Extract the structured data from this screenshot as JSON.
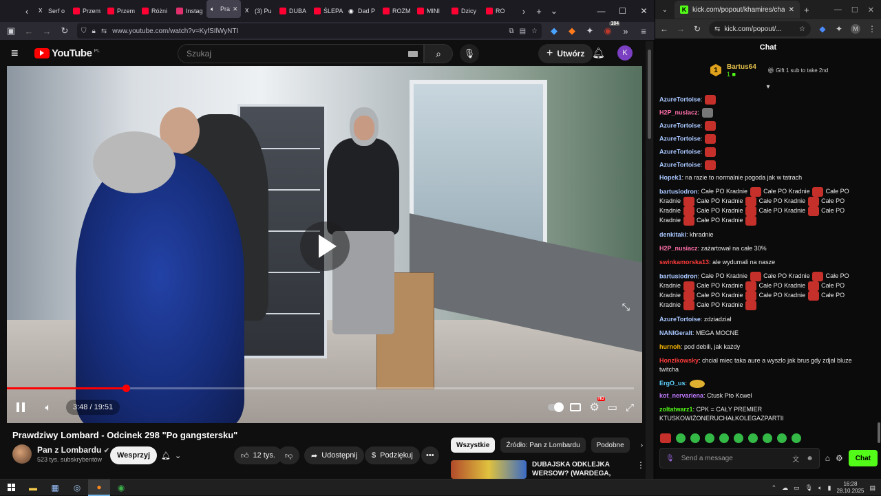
{
  "left_browser": {
    "tabs": [
      {
        "label": "Serf o",
        "color": "#ffffff",
        "icon": "x-icon"
      },
      {
        "label": "Przem",
        "color": "#ff0033",
        "icon": "youtube-icon"
      },
      {
        "label": "Przem",
        "color": "#ff0033",
        "icon": "youtube-icon"
      },
      {
        "label": "Różni",
        "color": "#ff0033",
        "icon": "youtube-icon"
      },
      {
        "label": "Instag",
        "color": "#e1306c",
        "icon": "instagram-icon"
      },
      {
        "label": "Pra",
        "color": "#ff0033",
        "icon": "speaker-icon",
        "active": true
      },
      {
        "label": "(3) Pu",
        "color": "#ffffff",
        "icon": "x-icon"
      },
      {
        "label": "DUBA",
        "color": "#ff0033",
        "icon": "youtube-icon"
      },
      {
        "label": "ŚLEPA",
        "color": "#ff0033",
        "icon": "youtube-icon"
      },
      {
        "label": "Dad P",
        "color": "#ffffff",
        "icon": "record-icon"
      },
      {
        "label": "ROZM",
        "color": "#ff0033",
        "icon": "youtube-icon"
      },
      {
        "label": "MINI",
        "color": "#ff0033",
        "icon": "youtube-icon"
      },
      {
        "label": "Dzicy",
        "color": "#ff0033",
        "icon": "youtube-icon"
      },
      {
        "label": "RO",
        "color": "#ff0033",
        "icon": "youtube-icon"
      }
    ],
    "url": "www.youtube.com/watch?v=KyfSIlWyNTI",
    "extension_badge": "184"
  },
  "youtube": {
    "logo_text": "YouTube",
    "region": "PL",
    "search_placeholder": "Szukaj",
    "create_label": "Utwórz",
    "avatar_letter": "K",
    "player": {
      "current_time": "3:48",
      "duration": "19:51",
      "time_display": "3:48 / 19:51",
      "progress_fraction": 0.19
    },
    "video_title": "Prawdziwy Lombard - Odcinek 298 \"Po gangstersku\"",
    "channel_name": "Pan z Lombardu",
    "subscribers": "523 tys. subskrybentów",
    "support_label": "Wesprzyj",
    "likes": "12 tys.",
    "share_label": "Udostępnij",
    "thanks_label": "Podziękuj",
    "filters": [
      "Wszystkie",
      "Źródło: Pan z Lombardu",
      "Podobne"
    ],
    "recommended_title": "DUBAJSKA ODKLEJKA WERSOW? (WARDEGA, NITRO"
  },
  "right_browser": {
    "tab_label": "kick.com/popout/khamires/cha",
    "url": "kick.com/popout/...",
    "profile_letter": "M"
  },
  "chat": {
    "header": "Chat",
    "pinned": {
      "rank": "1",
      "user": "Bartus64",
      "count": "1",
      "gift_text": "Gift 1 sub to take 2nd"
    },
    "messages": [
      {
        "user": "AzureTortoise",
        "color": "#a9c7ff",
        "text": "",
        "emotes": 1,
        "emote_type": "red"
      },
      {
        "user": "H2P_nusiacz",
        "color": "#ff6fa8",
        "text": "",
        "emotes": 1,
        "emote_type": "gray"
      },
      {
        "user": "AzureTortoise",
        "color": "#a9c7ff",
        "text": "",
        "emotes": 1,
        "emote_type": "red"
      },
      {
        "user": "AzureTortoise",
        "color": "#a9c7ff",
        "text": "",
        "emotes": 1,
        "emote_type": "red"
      },
      {
        "user": "AzureTortoise",
        "color": "#a9c7ff",
        "text": "",
        "emotes": 1,
        "emote_type": "red"
      },
      {
        "user": "AzureTortoise",
        "color": "#a9c7ff",
        "text": "",
        "emotes": 1,
        "emote_type": "red"
      },
      {
        "user": "Hopek1",
        "color": "#a9c7ff",
        "text": "na razie to normalnie pogoda jak w tatrach",
        "emotes": 0
      },
      {
        "user": "bartusiodron",
        "color": "#a9c7ff",
        "text": "Całe PO Kradnie [e] Całe PO Kradnie [e] Całe PO Kradnie [e] Całe PO Kradnie [e] Całe PO Kradnie [e] Całe PO Kradnie [e] Całe PO Kradnie [e] Całe PO Kradnie [e] Całe PO Kradnie [e] Całe PO Kradnie [e]",
        "emotes": 0
      },
      {
        "user": "denkitaki",
        "color": "#a9c7ff",
        "text": "khradnie",
        "emotes": 0
      },
      {
        "user": "H2P_nusiacz",
        "color": "#ff6fa8",
        "text": "zażartował na całe 30%",
        "emotes": 0
      },
      {
        "user": "swinkamorska13",
        "color": "#ff3b3b",
        "text": "ale wydumali na nasze",
        "emotes": 0
      },
      {
        "user": "bartusiodron",
        "color": "#a9c7ff",
        "text": "Całe PO Kradnie [e] Całe PO Kradnie [e] Całe PO Kradnie [e] Całe PO Kradnie [e] Całe PO Kradnie [e] Całe PO Kradnie [e] Całe PO Kradnie [e] Całe PO Kradnie [e] Całe PO Kradnie [e] Całe PO Kradnie [e]",
        "emotes": 0
      },
      {
        "user": "AzureTortoise",
        "color": "#a9c7ff",
        "text": "zdziadział",
        "emotes": 0
      },
      {
        "user": "NANIGeralt",
        "color": "#a9c7ff",
        "text": "MEGA MOCNE",
        "emotes": 0
      },
      {
        "user": "hurnoh",
        "color": "#f5b400",
        "text": "pod debili, jak każdy",
        "emotes": 0
      },
      {
        "user": "Honzikowsky",
        "color": "#ff3b3b",
        "text": "chcial miec taka aure a wyszlo jak brus gdy zdjal bluze twitcha",
        "emotes": 0
      },
      {
        "user": "ErgO_us",
        "color": "#5fd3ff",
        "text": "",
        "emotes": 1,
        "emote_type": "cool"
      },
      {
        "user": "kot_nervariena",
        "color": "#c07bff",
        "text": "Ctusk Pto Kcwel",
        "emotes": 0
      },
      {
        "user": "zoltatwarz1",
        "color": "#53fc18",
        "text": "CPK = CAŁY PREMIER KTUSKOWIŻONERUCHAŁKOLEGAZPARTII",
        "emotes": 0
      }
    ],
    "input_placeholder": "Send a message",
    "send_label": "Chat"
  },
  "taskbar": {
    "time": "16:28",
    "date": "28.10.2025"
  }
}
